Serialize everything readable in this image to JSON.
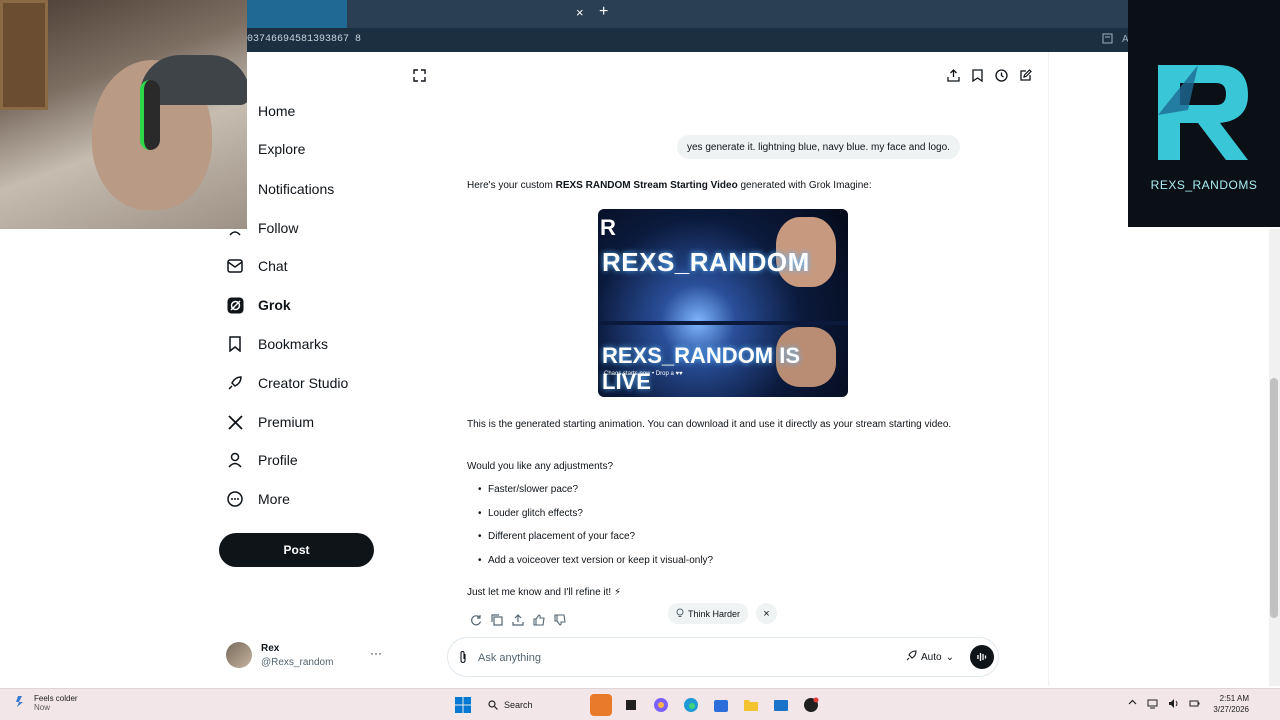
{
  "browser": {
    "url_fragment": "03746694581393867 8",
    "tab_close": "×",
    "new_tab": "+",
    "url_badge": "A"
  },
  "overlay": {
    "logo_text": "REXS_RANDOMS",
    "logo_color": "#39c6d6"
  },
  "nav": {
    "items": [
      {
        "label": "Home",
        "icon": "home-icon"
      },
      {
        "label": "Explore",
        "icon": "search-icon"
      },
      {
        "label": "Notifications",
        "icon": "bell-icon"
      },
      {
        "label": "Follow",
        "icon": "follow-icon"
      },
      {
        "label": "Chat",
        "icon": "mail-icon"
      },
      {
        "label": "Grok",
        "icon": "grok-icon"
      },
      {
        "label": "Bookmarks",
        "icon": "bookmark-icon"
      },
      {
        "label": "Creator Studio",
        "icon": "rocket-icon"
      },
      {
        "label": "Premium",
        "icon": "x-logo-icon"
      },
      {
        "label": "Profile",
        "icon": "person-icon"
      },
      {
        "label": "More",
        "icon": "more-circle-icon"
      }
    ],
    "post_label": "Post"
  },
  "profile": {
    "name": "Rex",
    "handle": "@Rexs_random",
    "more": "···"
  },
  "chat": {
    "user_message": "yes generate it. lightning blue, navy blue. my face and logo.",
    "intro_prefix": "Here's your custom ",
    "intro_bold": "REXS RANDOM Stream Starting Video",
    "intro_suffix": " generated with Grok Imagine:",
    "thumb_title_1": "REXS_RANDOM",
    "thumb_title_2": "REXS_RANDOM IS LIVE",
    "thumb_caption": "Chaos starts now • Drop a ♥♥",
    "thumb_mark": "R",
    "description": "This is the generated starting animation. You can download it and use it directly as your stream starting video.",
    "question": "Would you like any adjustments?",
    "adjustments": [
      "Faster/slower pace?",
      "Louder glitch effects?",
      "Different placement of your face?",
      "Add a voiceover text version or keep it visual-only?"
    ],
    "closing": "Just let me know and I'll refine it! ⚡",
    "think_harder": "Think Harder",
    "dismiss": "×"
  },
  "composer": {
    "placeholder": "Ask anything",
    "mode": "Auto",
    "mode_chevron": "⌄"
  },
  "taskbar": {
    "weather_title": "Feels colder",
    "weather_sub": "Now",
    "search_label": "Search",
    "time": "2:51 AM",
    "date": "3/27/2026"
  },
  "colors": {
    "tab_bar": "#2a3f52",
    "tab_active": "#1e6a95",
    "text_primary": "#0f1419",
    "text_secondary": "#536471"
  }
}
